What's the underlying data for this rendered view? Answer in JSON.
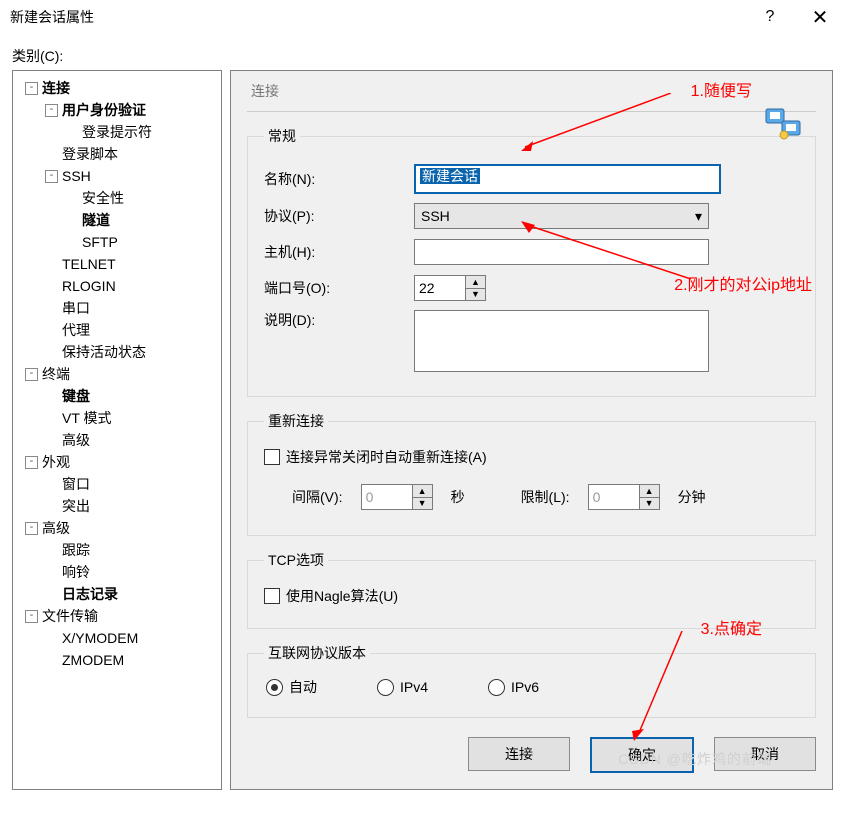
{
  "window": {
    "title": "新建会话属性",
    "help": "?",
    "close": "×"
  },
  "category_label": "类别(C):",
  "tree": [
    {
      "depth": 0,
      "toggle": "-",
      "label": "连接",
      "bold": true
    },
    {
      "depth": 1,
      "toggle": "-",
      "label": "用户身份验证",
      "bold": true
    },
    {
      "depth": 2,
      "toggle": "",
      "label": "登录提示符"
    },
    {
      "depth": 1,
      "toggle": "",
      "label": "登录脚本"
    },
    {
      "depth": 1,
      "toggle": "-",
      "label": "SSH"
    },
    {
      "depth": 2,
      "toggle": "",
      "label": "安全性"
    },
    {
      "depth": 2,
      "toggle": "",
      "label": "隧道",
      "bold": true
    },
    {
      "depth": 2,
      "toggle": "",
      "label": "SFTP"
    },
    {
      "depth": 1,
      "toggle": "",
      "label": "TELNET"
    },
    {
      "depth": 1,
      "toggle": "",
      "label": "RLOGIN"
    },
    {
      "depth": 1,
      "toggle": "",
      "label": "串口"
    },
    {
      "depth": 1,
      "toggle": "",
      "label": "代理"
    },
    {
      "depth": 1,
      "toggle": "",
      "label": "保持活动状态"
    },
    {
      "depth": 0,
      "toggle": "-",
      "label": "终端"
    },
    {
      "depth": 1,
      "toggle": "",
      "label": "键盘",
      "bold": true
    },
    {
      "depth": 1,
      "toggle": "",
      "label": "VT 模式"
    },
    {
      "depth": 1,
      "toggle": "",
      "label": "高级"
    },
    {
      "depth": 0,
      "toggle": "-",
      "label": "外观"
    },
    {
      "depth": 1,
      "toggle": "",
      "label": "窗口"
    },
    {
      "depth": 1,
      "toggle": "",
      "label": "突出"
    },
    {
      "depth": 0,
      "toggle": "-",
      "label": "高级"
    },
    {
      "depth": 1,
      "toggle": "",
      "label": "跟踪"
    },
    {
      "depth": 1,
      "toggle": "",
      "label": "响铃"
    },
    {
      "depth": 1,
      "toggle": "",
      "label": "日志记录",
      "bold": true
    },
    {
      "depth": 0,
      "toggle": "-",
      "label": "文件传输"
    },
    {
      "depth": 1,
      "toggle": "",
      "label": "X/YMODEM"
    },
    {
      "depth": 1,
      "toggle": "",
      "label": "ZMODEM"
    }
  ],
  "page": {
    "heading": "连接",
    "general_legend": "常规",
    "name_label": "名称(N):",
    "name_value": "新建会话",
    "protocol_label": "协议(P):",
    "protocol_value": "SSH",
    "host_label": "主机(H):",
    "host_value": "",
    "port_label": "端口号(O):",
    "port_value": "22",
    "desc_label": "说明(D):",
    "desc_value": "",
    "reconnect_legend": "重新连接",
    "reconnect_chk": "连接异常关闭时自动重新连接(A)",
    "interval_label": "间隔(V):",
    "interval_value": "0",
    "seconds": "秒",
    "limit_label": "限制(L):",
    "limit_value": "0",
    "minutes": "分钟",
    "tcp_legend": "TCP选项",
    "nagle_chk": "使用Nagle算法(U)",
    "ipver_legend": "互联网协议版本",
    "ip_auto": "自动",
    "ip_v4": "IPv4",
    "ip_v6": "IPv6"
  },
  "buttons": {
    "connect": "连接",
    "ok": "确定",
    "cancel": "取消"
  },
  "annotations": {
    "a1": "1.随便写",
    "a2": "2.刚才的对公ip地址",
    "a3": "3.点确定"
  },
  "watermark": "CSDN @吃炸鸡的前端"
}
